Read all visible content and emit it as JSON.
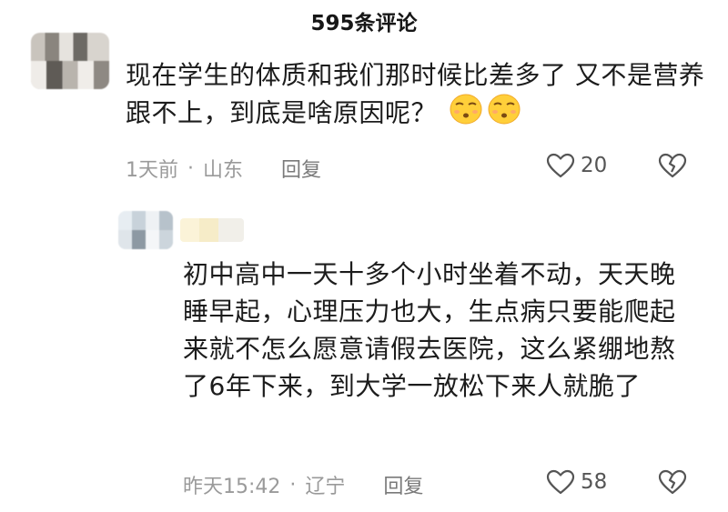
{
  "header": {
    "title": "595条评论"
  },
  "comments": [
    {
      "text": "现在学生的体质和我们那时候比差多了 又不是营养跟不上，到底是啥原因呢？",
      "emojis": [
        "pouting-face-emoji",
        "pouting-face-emoji"
      ],
      "time": "1天前",
      "location": "山东",
      "reply_label": "回复",
      "likes": "20"
    },
    {
      "text": "初中高中一天十多个小时坐着不动，天天晚睡早起，心理压力也大，生点病只要能爬起来就不怎么愿意请假去医院，这么紧绷地熬了6年下来，到大学一放松下来人就脆了",
      "time": "昨天15:42",
      "location": "辽宁",
      "reply_label": "回复",
      "likes": "58"
    }
  ],
  "separator": "·",
  "icons": {
    "like": "heart-outline-icon",
    "dislike": "broken-heart-outline-icon"
  }
}
